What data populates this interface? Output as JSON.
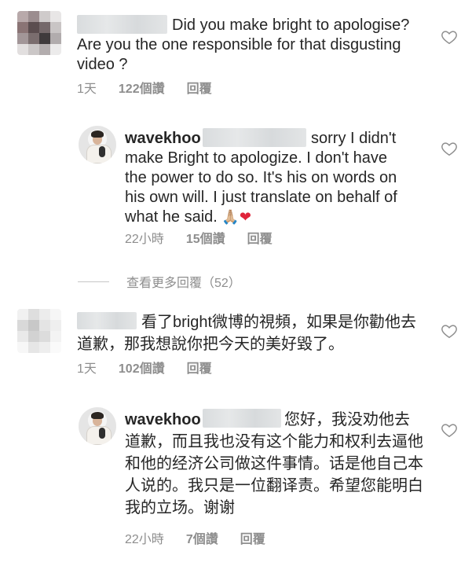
{
  "comments": [
    {
      "text_line1": "Did you make bright to apologise?",
      "text_line2": "Are you the one responsible for that disgusting",
      "text_line3": "video ?",
      "time": "1天",
      "likes": "122個讚",
      "reply": "回覆"
    },
    {
      "username": "wavekhoo",
      "text_line1": "sorry I didn't",
      "text_line2": "make Bright to apologize. I don't have",
      "text_line3": "the power to do so. It's his on words on",
      "text_line4": "his own will. I just translate on behalf of",
      "text_line5": "what he said.",
      "time": "22小時",
      "likes": "15個讚",
      "reply": "回覆"
    },
    {
      "text_line1": "看了bright微博的視頻，如果是你勸他去",
      "text_line2": "道歉，那我想說你把今天的美好毀了。",
      "time": "1天",
      "likes": "102個讚",
      "reply": "回覆"
    },
    {
      "username": "wavekhoo",
      "text_line1": "您好，我没劝他去",
      "text_line2": "道歉，而且我也没有这个能力和权利去逼他",
      "text_line3": "和他的经济公司做这件事情。话是他自己本",
      "text_line4": "人说的。我只是一位翻译责。希望您能明白",
      "text_line5": "我的立场。谢谢",
      "time": "22小時",
      "likes": "7個讚",
      "reply": "回覆"
    }
  ],
  "view_more": "查看更多回覆（52）",
  "emojis": {
    "pray": "🙏🏼",
    "heart": "❤"
  },
  "icons": {
    "like": "heart-outline-icon"
  }
}
